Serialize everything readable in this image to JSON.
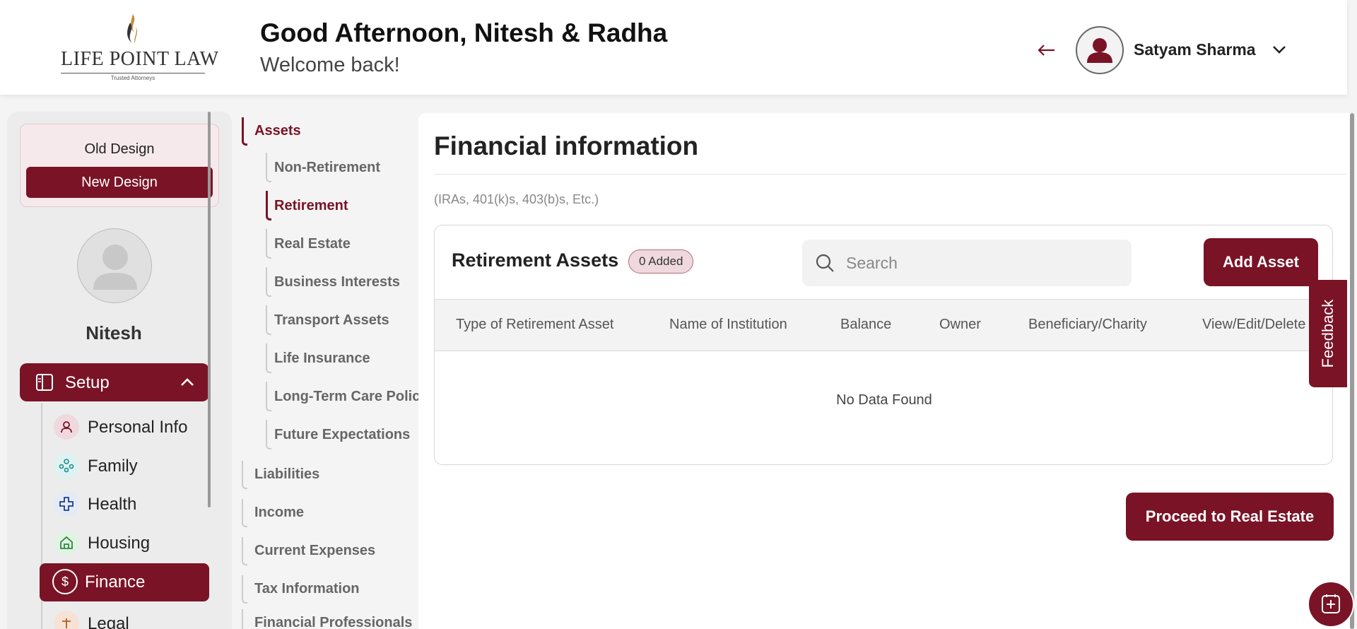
{
  "header": {
    "logo_text": "LIFE POINT LAW",
    "logo_tagline": "Trusted Attorneys",
    "greeting": "Good Afternoon, Nitesh & Radha",
    "welcome": "Welcome back!",
    "user_name": "Satyam Sharma"
  },
  "sidebar": {
    "old_design": "Old Design",
    "new_design": "New Design",
    "profile_name": "Nitesh",
    "setup_label": "Setup",
    "items": [
      {
        "label": "Personal Info",
        "icon": "person-icon"
      },
      {
        "label": "Family",
        "icon": "family-icon"
      },
      {
        "label": "Health",
        "icon": "health-cross-icon"
      },
      {
        "label": "Housing",
        "icon": "house-icon"
      },
      {
        "label": "Finance",
        "icon": "dollar-icon"
      },
      {
        "label": "Legal",
        "icon": "legal-icon"
      }
    ]
  },
  "subnav": {
    "assets": "Assets",
    "asset_items": [
      "Non-Retirement",
      "Retirement",
      "Real Estate",
      "Business Interests",
      "Transport Assets",
      "Life Insurance",
      "Long-Term Care Policy",
      "Future Expectations"
    ],
    "sections": [
      "Liabilities",
      "Income",
      "Current Expenses",
      "Tax Information",
      "Financial Professionals"
    ]
  },
  "main": {
    "title": "Financial information",
    "hint": "(IRAs, 401(k)s, 403(b)s, Etc.)",
    "card_title": "Retirement Assets",
    "added_badge": "0 Added",
    "search_placeholder": "Search",
    "add_button": "Add Asset",
    "columns": [
      "Type of Retirement Asset",
      "Name of Institution",
      "Balance",
      "Owner",
      "Beneficiary/Charity",
      "View/Edit/Delete"
    ],
    "no_data": "No Data Found",
    "proceed_button": "Proceed to Real Estate"
  },
  "feedback": "Feedback",
  "colors": {
    "brand": "#7a1326",
    "badge_bg": "#f0d9de"
  }
}
